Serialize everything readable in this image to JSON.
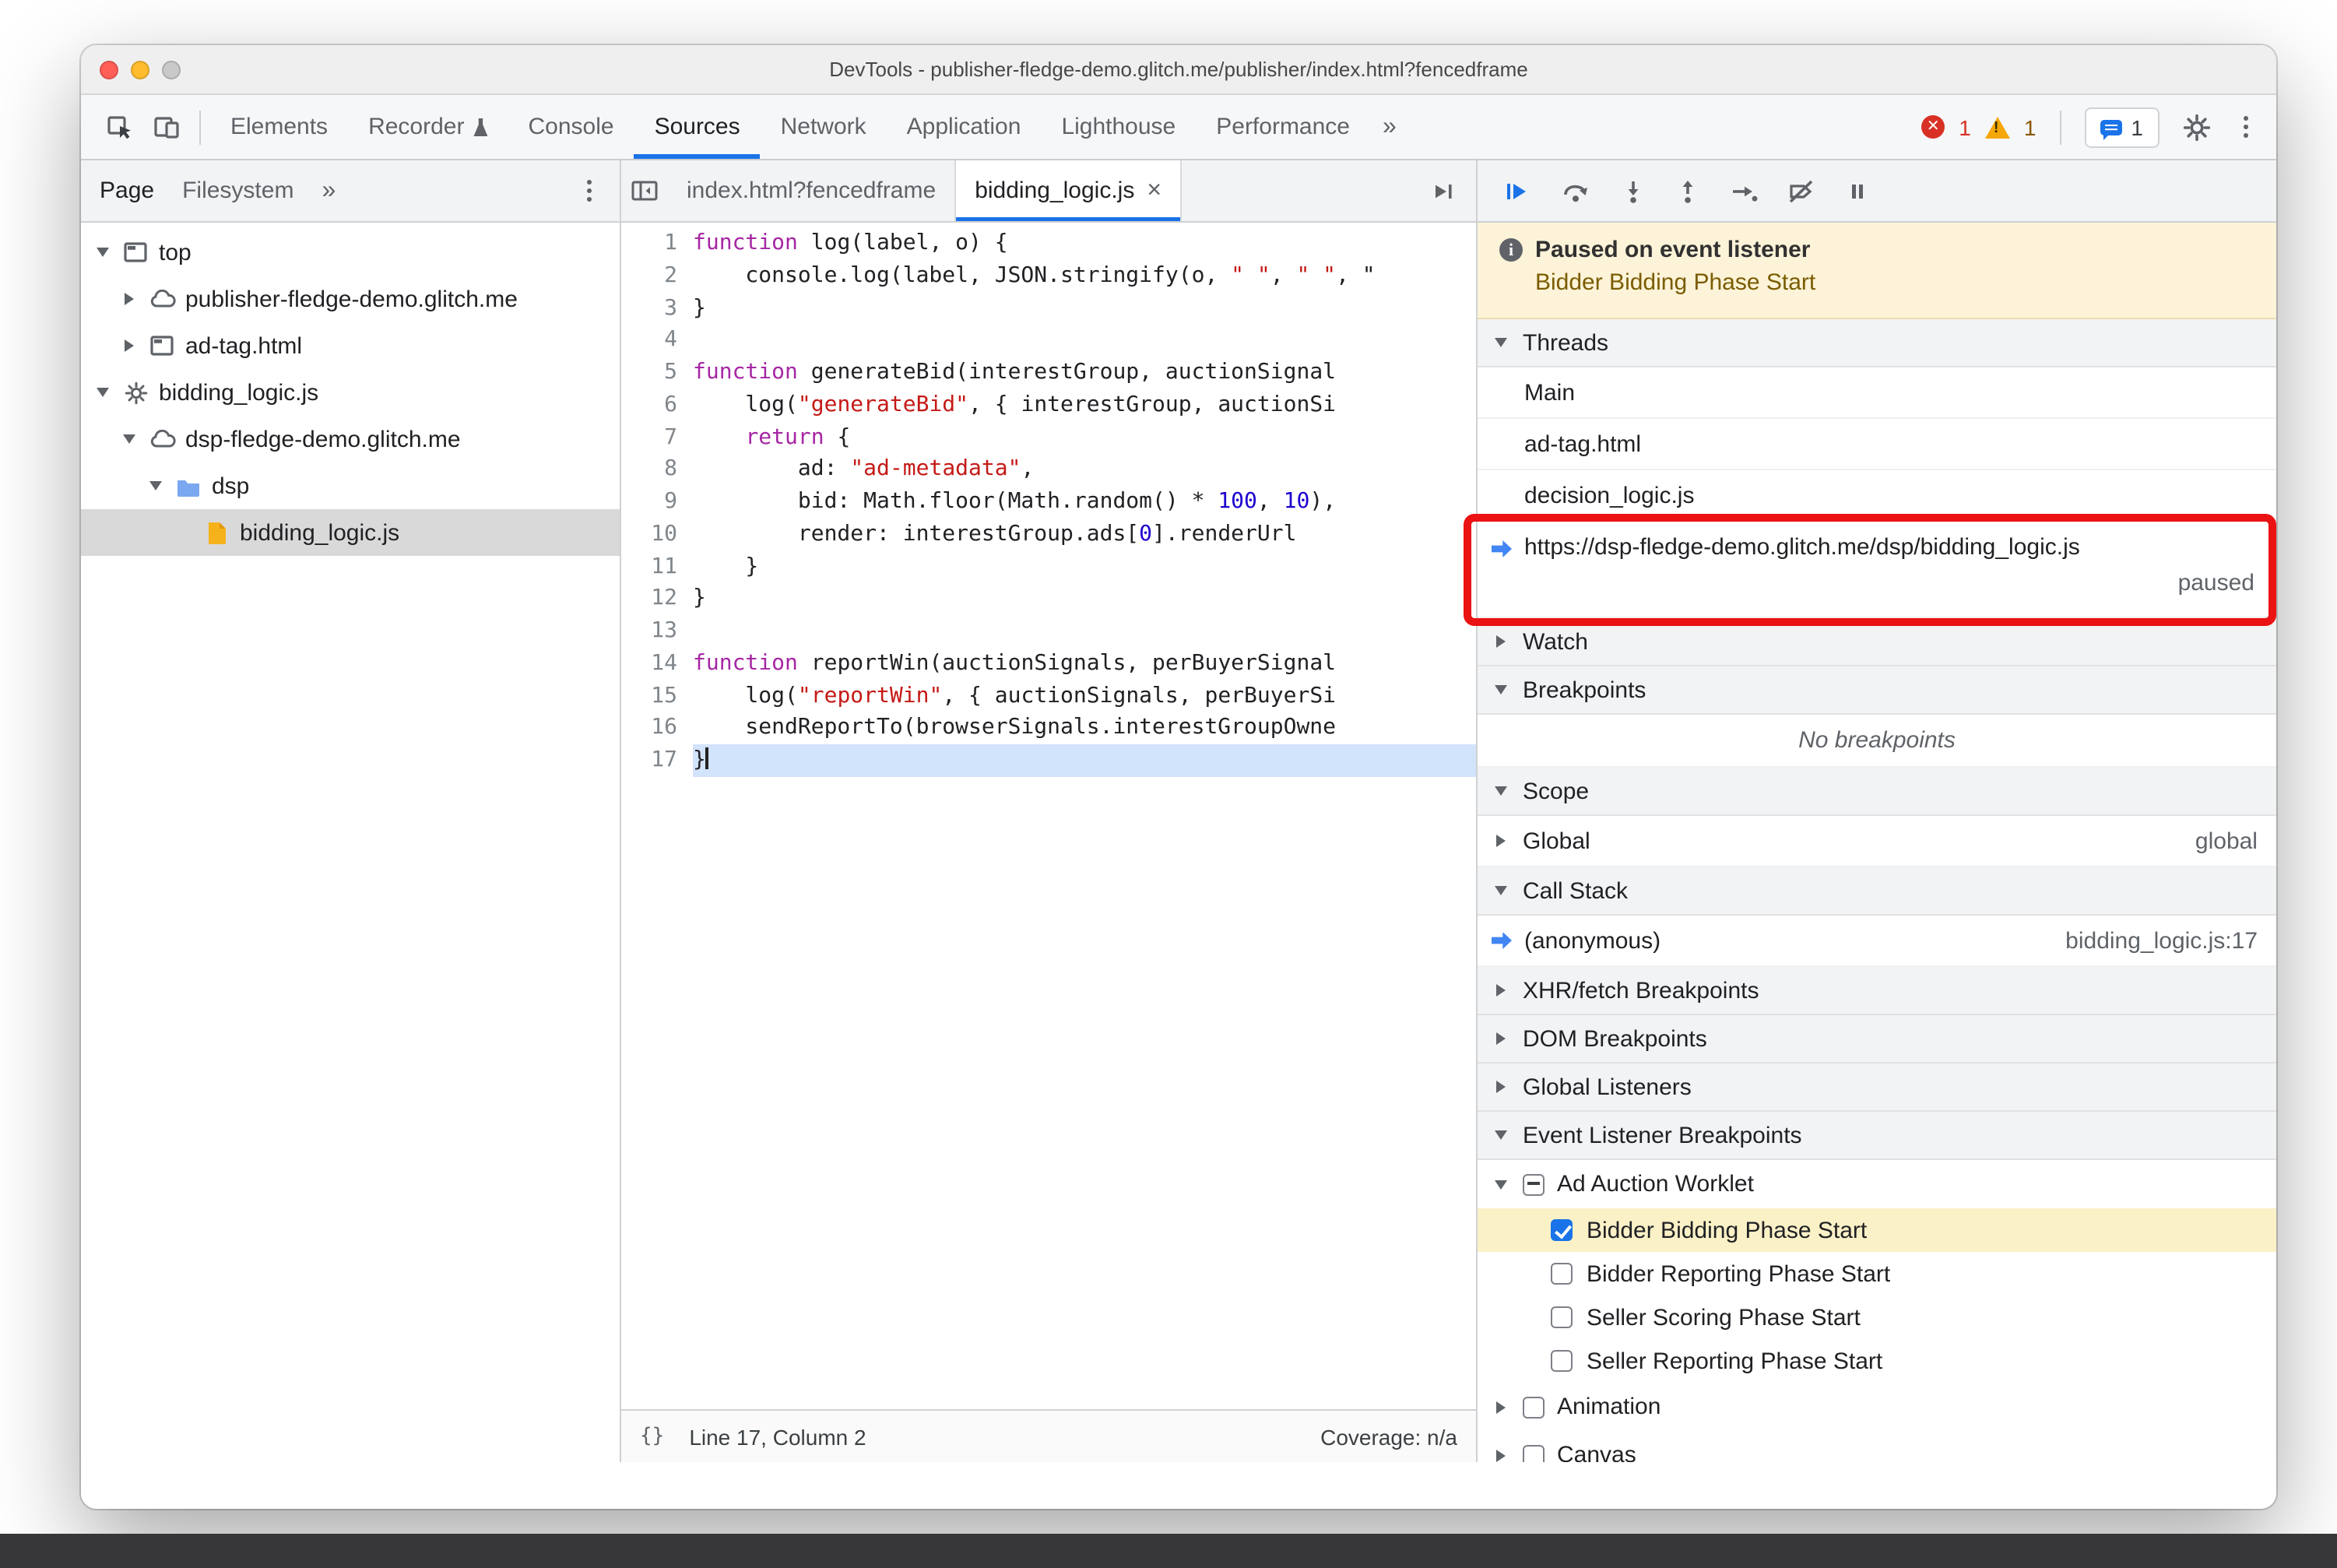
{
  "window": {
    "title": "DevTools - publisher-fledge-demo.glitch.me/publisher/index.html?fencedframe"
  },
  "colors": {
    "accent": "#1a73e8",
    "error": "#d93025",
    "warning": "#f5a70a",
    "annotation_red": "#ea1212",
    "paused_banner_bg": "#fcf3d8",
    "breakpoint_highlight": "#fbf1c7"
  },
  "main_toolbar": {
    "tabs": [
      {
        "label": "Elements"
      },
      {
        "label": "Recorder",
        "badge": "flask-icon"
      },
      {
        "label": "Console"
      },
      {
        "label": "Sources",
        "active": true
      },
      {
        "label": "Network"
      },
      {
        "label": "Application"
      },
      {
        "label": "Lighthouse"
      },
      {
        "label": "Performance"
      }
    ],
    "more_tabs": "»",
    "status": {
      "errors": "1",
      "warnings": "1",
      "issues": "1"
    }
  },
  "navigator": {
    "tabs": [
      {
        "label": "Page",
        "active": true
      },
      {
        "label": "Filesystem"
      }
    ],
    "more_tabs": "»",
    "tree": [
      {
        "label": "top",
        "icon": "frame-icon",
        "depth": 0,
        "arrow": "expanded"
      },
      {
        "label": "publisher-fledge-demo.glitch.me",
        "icon": "cloud-icon",
        "depth": 1,
        "arrow": "collapsed"
      },
      {
        "label": "ad-tag.html",
        "icon": "frame-icon",
        "depth": 1,
        "arrow": "collapsed"
      },
      {
        "label": "bidding_logic.js",
        "icon": "gear-icon",
        "depth": 0,
        "arrow": "expanded"
      },
      {
        "label": "dsp-fledge-demo.glitch.me",
        "icon": "cloud-icon",
        "depth": 1,
        "arrow": "expanded"
      },
      {
        "label": "dsp",
        "icon": "folder-icon",
        "depth": 2,
        "arrow": "expanded"
      },
      {
        "label": "bidding_logic.js",
        "icon": "js-file-icon",
        "depth": 3,
        "arrow": "none",
        "selected": true
      }
    ]
  },
  "editor": {
    "tabs": [
      {
        "label": "index.html?fencedframe"
      },
      {
        "label": "bidding_logic.js",
        "active": true,
        "close": "×"
      }
    ],
    "lines": [
      {
        "n": "1",
        "tokens": [
          [
            "kw",
            "function"
          ],
          [
            "pl",
            " log(label, o) {"
          ]
        ]
      },
      {
        "n": "2",
        "tokens": [
          [
            "pl",
            "    console.log(label, JSON.stringify(o, "
          ],
          [
            "str",
            "\" \""
          ],
          [
            "pl",
            ", "
          ],
          [
            "str",
            "\" \""
          ],
          [
            "pl",
            ", \""
          ]
        ]
      },
      {
        "n": "3",
        "tokens": [
          [
            "pl",
            "}"
          ]
        ]
      },
      {
        "n": "4",
        "tokens": []
      },
      {
        "n": "5",
        "tokens": [
          [
            "kw",
            "function"
          ],
          [
            "pl",
            " generateBid(interestGroup, auctionSignal"
          ]
        ]
      },
      {
        "n": "6",
        "tokens": [
          [
            "pl",
            "    log("
          ],
          [
            "str",
            "\"generateBid\""
          ],
          [
            "pl",
            ", { interestGroup, auctionSi"
          ]
        ]
      },
      {
        "n": "7",
        "tokens": [
          [
            "pl",
            "    "
          ],
          [
            "kw",
            "return"
          ],
          [
            "pl",
            " {"
          ]
        ]
      },
      {
        "n": "8",
        "tokens": [
          [
            "pl",
            "        ad: "
          ],
          [
            "str",
            "\"ad-metadata\""
          ],
          [
            "pl",
            ","
          ]
        ]
      },
      {
        "n": "9",
        "tokens": [
          [
            "pl",
            "        bid: Math.floor(Math.random() * "
          ],
          [
            "num",
            "100"
          ],
          [
            "pl",
            ", "
          ],
          [
            "num",
            "10"
          ],
          [
            "pl",
            "),"
          ]
        ]
      },
      {
        "n": "10",
        "tokens": [
          [
            "pl",
            "        render: interestGroup.ads["
          ],
          [
            "num",
            "0"
          ],
          [
            "pl",
            "].renderUrl"
          ]
        ]
      },
      {
        "n": "11",
        "tokens": [
          [
            "pl",
            "    }"
          ]
        ]
      },
      {
        "n": "12",
        "tokens": [
          [
            "pl",
            "}"
          ]
        ]
      },
      {
        "n": "13",
        "tokens": []
      },
      {
        "n": "14",
        "tokens": [
          [
            "kw",
            "function"
          ],
          [
            "pl",
            " reportWin(auctionSignals, perBuyerSignal"
          ]
        ]
      },
      {
        "n": "15",
        "tokens": [
          [
            "pl",
            "    log("
          ],
          [
            "str",
            "\"reportWin\""
          ],
          [
            "pl",
            ", { auctionSignals, perBuyerSi"
          ]
        ]
      },
      {
        "n": "16",
        "tokens": [
          [
            "pl",
            "    sendReportTo(browserSignals.interestGroupOwne"
          ]
        ]
      },
      {
        "n": "17",
        "tokens": [
          [
            "pl",
            "}"
          ]
        ],
        "current": true
      }
    ],
    "status": {
      "format": "{}",
      "position": "Line 17, Column 2",
      "coverage": "Coverage: n/a"
    }
  },
  "debugger": {
    "paused": {
      "title": "Paused on event listener",
      "reason": "Bidder Bidding Phase Start"
    },
    "threads": {
      "title": "Threads",
      "items": [
        {
          "label": "Main"
        },
        {
          "label": "ad-tag.html"
        },
        {
          "label": "decision_logic.js"
        },
        {
          "label": "https://dsp-fledge-demo.glitch.me/dsp/bidding_logic.js",
          "status": "paused",
          "current": true
        }
      ]
    },
    "watch": {
      "title": "Watch"
    },
    "breakpoints": {
      "title": "Breakpoints",
      "empty": "No breakpoints"
    },
    "scope": {
      "title": "Scope",
      "items": [
        {
          "label": "Global",
          "value": "global"
        }
      ]
    },
    "call_stack": {
      "title": "Call Stack",
      "items": [
        {
          "label": "(anonymous)",
          "location": "bidding_logic.js:17",
          "current": true
        }
      ]
    },
    "xhr_breakpoints": {
      "title": "XHR/fetch Breakpoints"
    },
    "dom_breakpoints": {
      "title": "DOM Breakpoints"
    },
    "global_listeners": {
      "title": "Global Listeners"
    },
    "event_listener_breakpoints": {
      "title": "Event Listener Breakpoints",
      "categories": [
        {
          "label": "Ad Auction Worklet",
          "checkbox": "indeterminate",
          "expanded": true,
          "items": [
            {
              "label": "Bidder Bidding Phase Start",
              "checked": true,
              "highlighted": true
            },
            {
              "label": "Bidder Reporting Phase Start",
              "checked": false
            },
            {
              "label": "Seller Scoring Phase Start",
              "checked": false
            },
            {
              "label": "Seller Reporting Phase Start",
              "checked": false
            }
          ]
        },
        {
          "label": "Animation",
          "checkbox": "unchecked",
          "expanded": false,
          "items": []
        },
        {
          "label": "Canvas",
          "checkbox": "unchecked",
          "expanded": false,
          "items": []
        }
      ]
    }
  }
}
